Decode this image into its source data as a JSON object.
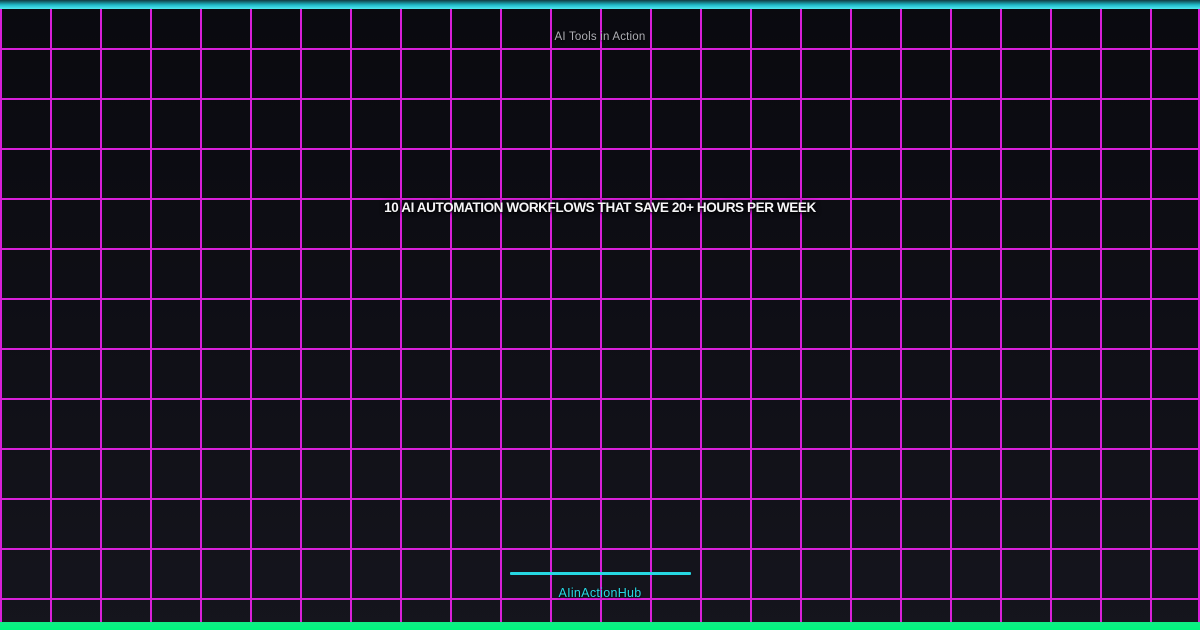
{
  "banner": {
    "kicker": "AI Tools in Action",
    "title": "10 AI AUTOMATION WORKFLOWS THAT SAVE 20+ HOURS PER WEEK",
    "brand": "AIinActionHub"
  },
  "theme": {
    "background-top": "#0a0a0f",
    "background-mid": "#0e0e15",
    "background-bottom": "#15151d",
    "grid-line": "#e421e4",
    "top-bar-dark": "#113a40",
    "top-bar-mid": "#1fb9c8",
    "top-bar-bright": "#55e9f2",
    "bottom-bar-start": "#11ed86",
    "bottom-bar-end": "#00f57e",
    "accent-cyan": "#26d7e2",
    "kicker-color": "#aeaeb4",
    "title-color": "#f5f5f7"
  }
}
